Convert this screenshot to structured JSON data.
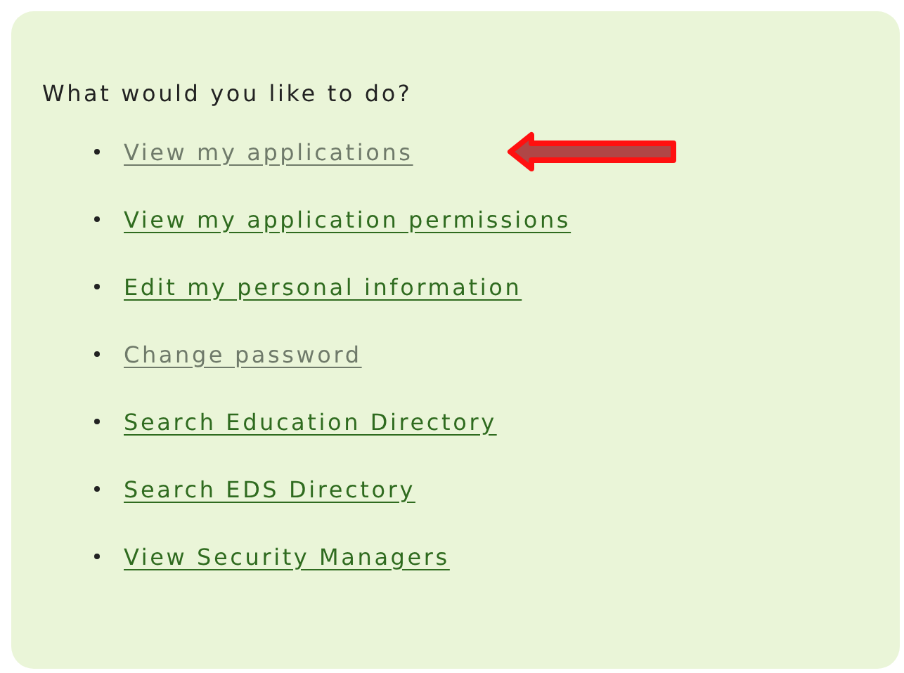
{
  "prompt": "What would you like to do?",
  "links": [
    {
      "label": "View my applications",
      "visited": true,
      "marked": true
    },
    {
      "label": "View my application permissions",
      "visited": false,
      "marked": false
    },
    {
      "label": "Edit my personal information",
      "visited": false,
      "marked": false
    },
    {
      "label": "Change password",
      "visited": true,
      "marked": false
    },
    {
      "label": "Search Education Directory",
      "visited": false,
      "marked": false
    },
    {
      "label": "Search EDS Directory",
      "visited": false,
      "marked": false
    },
    {
      "label": "View Security Managers",
      "visited": false,
      "marked": false
    }
  ]
}
